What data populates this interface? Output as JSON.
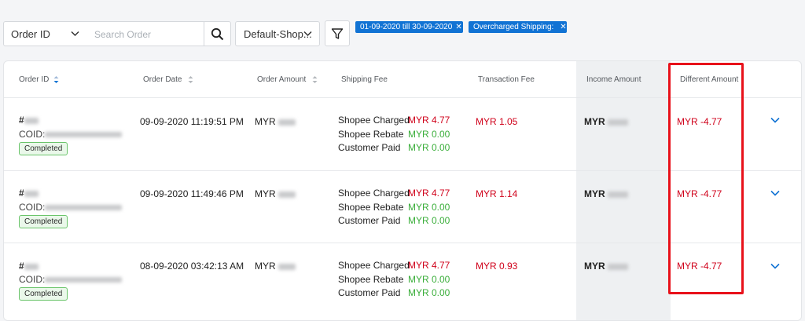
{
  "filters": {
    "order_field_select": "Order ID",
    "search_placeholder": "Search Order",
    "shop_select": "Default-Shop...",
    "chips": [
      {
        "label": "01-09-2020 till 30-09-2020"
      },
      {
        "label": "Overcharged Shipping:"
      }
    ]
  },
  "columns": {
    "order_id": "Order ID",
    "order_date": "Order Date",
    "order_amount": "Order Amount",
    "shipping_fee": "Shipping Fee",
    "transaction_fee": "Transaction Fee",
    "income_amount": "Income Amount",
    "different_amount": "Different Amount"
  },
  "orders": [
    {
      "order_prefix": "#",
      "coid_prefix": "COID:",
      "status": "Completed",
      "date": "09-09-2020 11:19:51 PM",
      "amount_currency": "MYR",
      "shipping": [
        {
          "label": "Shopee Charged",
          "value": "MYR 4.77"
        },
        {
          "label": "Shopee Rebate",
          "value": "MYR 0.00"
        },
        {
          "label": "Customer Paid",
          "value": "MYR 0.00"
        }
      ],
      "transaction_fee": "MYR 1.05",
      "income_currency": "MYR",
      "different_amount": "MYR -4.77"
    },
    {
      "order_prefix": "#",
      "coid_prefix": "COID:",
      "status": "Completed",
      "date": "09-09-2020 11:49:46 PM",
      "amount_currency": "MYR",
      "shipping": [
        {
          "label": "Shopee Charged",
          "value": "MYR 4.77"
        },
        {
          "label": "Shopee Rebate",
          "value": "MYR 0.00"
        },
        {
          "label": "Customer Paid",
          "value": "MYR 0.00"
        }
      ],
      "transaction_fee": "MYR 1.14",
      "income_currency": "MYR",
      "different_amount": "MYR -4.77"
    },
    {
      "order_prefix": "#",
      "coid_prefix": "COID:",
      "status": "Completed",
      "date": "08-09-2020 03:42:13 AM",
      "amount_currency": "MYR",
      "shipping": [
        {
          "label": "Shopee Charged",
          "value": "MYR 4.77"
        },
        {
          "label": "Shopee Rebate",
          "value": "MYR 0.00"
        },
        {
          "label": "Customer Paid",
          "value": "MYR 0.00"
        }
      ],
      "transaction_fee": "MYR 0.93",
      "income_currency": "MYR",
      "different_amount": "MYR -4.77"
    }
  ],
  "colors": {
    "accent": "#1173d4",
    "negative": "#d0021b",
    "positive": "#3aae3a",
    "highlight": "#e8111a"
  }
}
